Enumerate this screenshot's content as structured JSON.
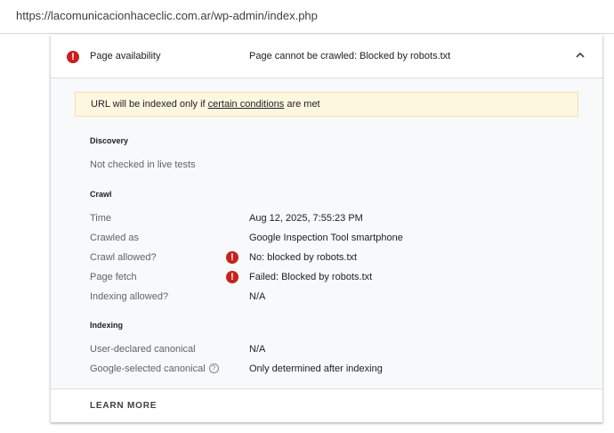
{
  "url": "https://lacomunicacionhaceclic.com.ar/wp-admin/index.php",
  "header": {
    "label": "Page availability",
    "value": "Page cannot be crawled: Blocked by robots.txt"
  },
  "banner": {
    "text_before": "URL will be indexed only if ",
    "link_text": "certain conditions",
    "text_after": " are met"
  },
  "discovery": {
    "title": "Discovery",
    "note": "Not checked in live tests"
  },
  "crawl": {
    "title": "Crawl",
    "rows": [
      {
        "label": "Time",
        "value": "Aug 12, 2025, 7:55:23 PM"
      },
      {
        "label": "Crawled as",
        "value": "Google Inspection Tool smartphone"
      },
      {
        "label": "Crawl allowed?",
        "value": "No: blocked by robots.txt"
      },
      {
        "label": "Page fetch",
        "value": "Failed: Blocked by robots.txt"
      },
      {
        "label": "Indexing allowed?",
        "value": "N/A"
      }
    ]
  },
  "indexing": {
    "title": "Indexing",
    "rows": [
      {
        "label": "User-declared canonical",
        "value": "N/A"
      },
      {
        "label": "Google-selected canonical",
        "value": "Only determined after indexing"
      }
    ]
  },
  "footer": {
    "learn_more": "LEARN MORE"
  },
  "colors": {
    "error": "#c5221f",
    "banner_bg": "#fef7e0"
  },
  "icons": {
    "error": "!",
    "help": "?"
  }
}
